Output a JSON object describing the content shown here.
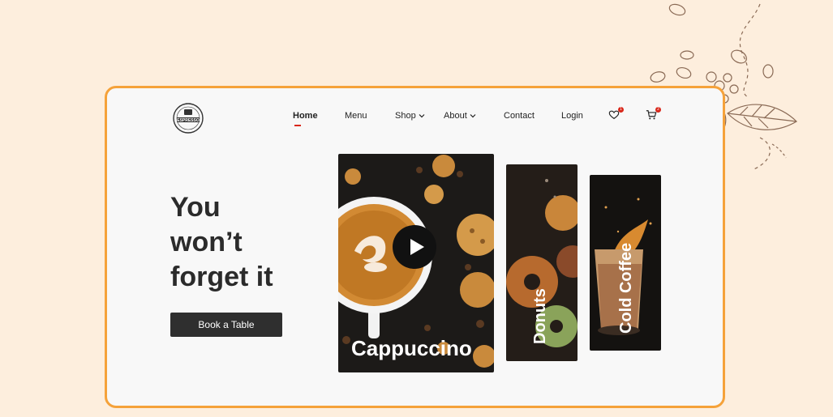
{
  "brand": {
    "logo_text": "ESPRESSO",
    "logo_sub": "COFFEE SHOP"
  },
  "nav": {
    "items": [
      {
        "label": "Home",
        "active": true
      },
      {
        "label": "Menu"
      },
      {
        "label": "Shop",
        "dropdown": true
      },
      {
        "label": "About",
        "dropdown": true
      },
      {
        "label": "Contact"
      },
      {
        "label": "Login"
      }
    ],
    "wishlist_badge": "1",
    "cart_badge": "2"
  },
  "hero": {
    "line1": "You",
    "line2": "won’t",
    "line3": "forget it",
    "cta_label": "Book a Table"
  },
  "cards": {
    "main_label": "Cappuccino",
    "second_label": "Donuts",
    "third_label": "Cold Coffee"
  },
  "colors": {
    "page_bg": "#fdeedd",
    "frame_border": "#f5a23a",
    "accent_red": "#d9271a",
    "button_dark": "#2f2f2f"
  },
  "icons": [
    "play-icon",
    "heart-icon",
    "cart-icon",
    "chevron-down-icon",
    "coffee-bean-icon"
  ]
}
